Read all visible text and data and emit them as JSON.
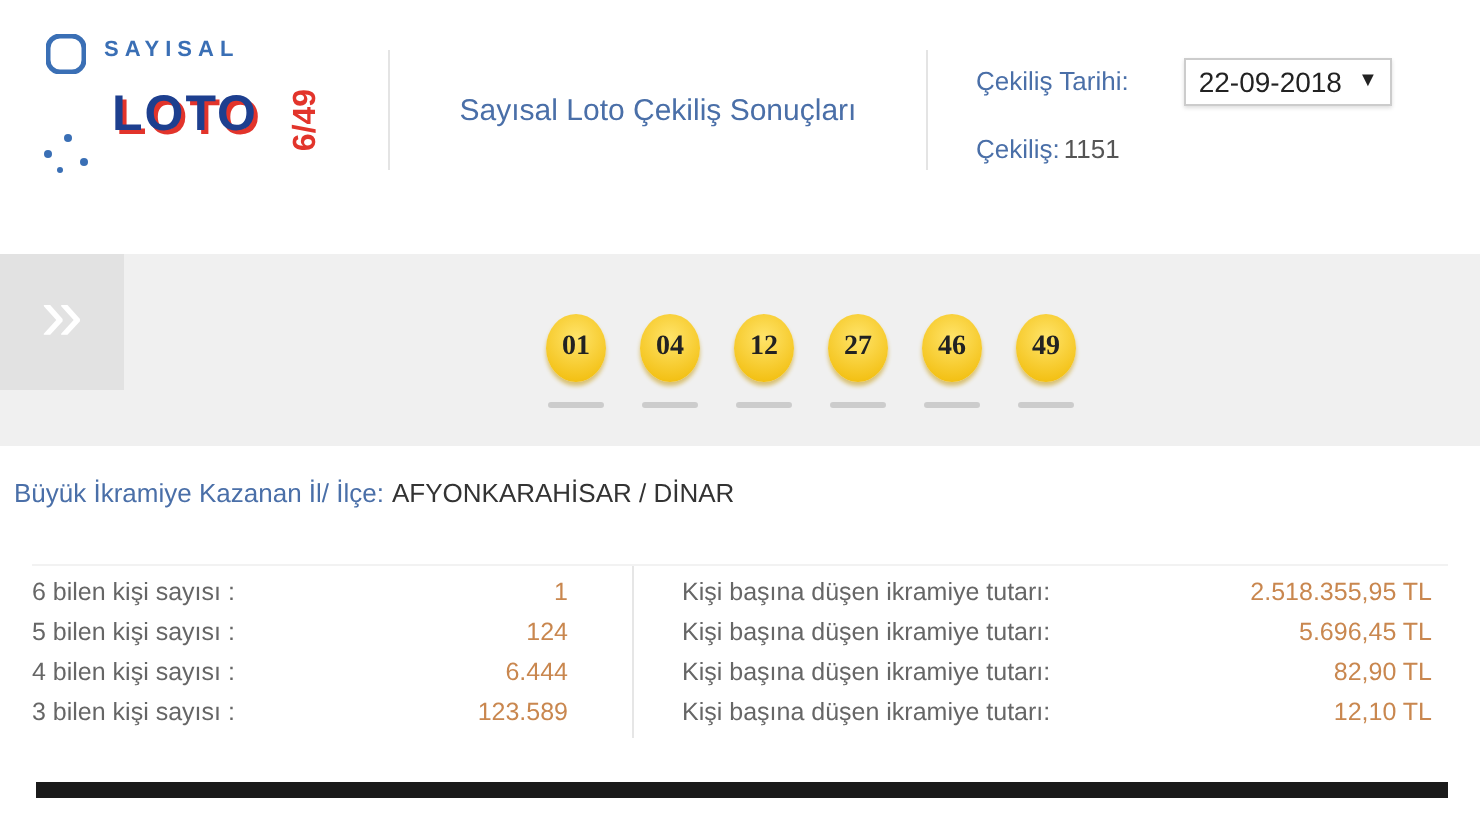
{
  "logo": {
    "top": "SAYISAL",
    "word": "LOTO",
    "side": "6/49"
  },
  "header": {
    "title": "Sayısal Loto Çekiliş Sonuçları",
    "date_label": "Çekiliş Tarihi:",
    "date_value": "22-09-2018",
    "date_caret": "▼",
    "draw_label": "Çekiliş:",
    "draw_number": "1151"
  },
  "band": {
    "toggle": "»",
    "balls": [
      "01",
      "04",
      "12",
      "27",
      "46",
      "49"
    ]
  },
  "winner": {
    "label": "Büyük İkramiye Kazanan İl/ İlçe:",
    "value": "AFYONKARAHİSAR / DİNAR"
  },
  "results": [
    {
      "label": "6 bilen kişi sayısı :",
      "count": "1",
      "prize_label": "Kişi başına düşen ikramiye tutarı:",
      "prize": "2.518.355,95 TL"
    },
    {
      "label": "5 bilen kişi sayısı :",
      "count": "124",
      "prize_label": "Kişi başına düşen ikramiye tutarı:",
      "prize": "5.696,45 TL"
    },
    {
      "label": "4 bilen kişi sayısı :",
      "count": "6.444",
      "prize_label": "Kişi başına düşen ikramiye tutarı:",
      "prize": "82,90 TL"
    },
    {
      "label": "3 bilen kişi sayısı :",
      "count": "123.589",
      "prize_label": "Kişi başına düşen ikramiye tutarı:",
      "prize": "12,10 TL"
    }
  ]
}
